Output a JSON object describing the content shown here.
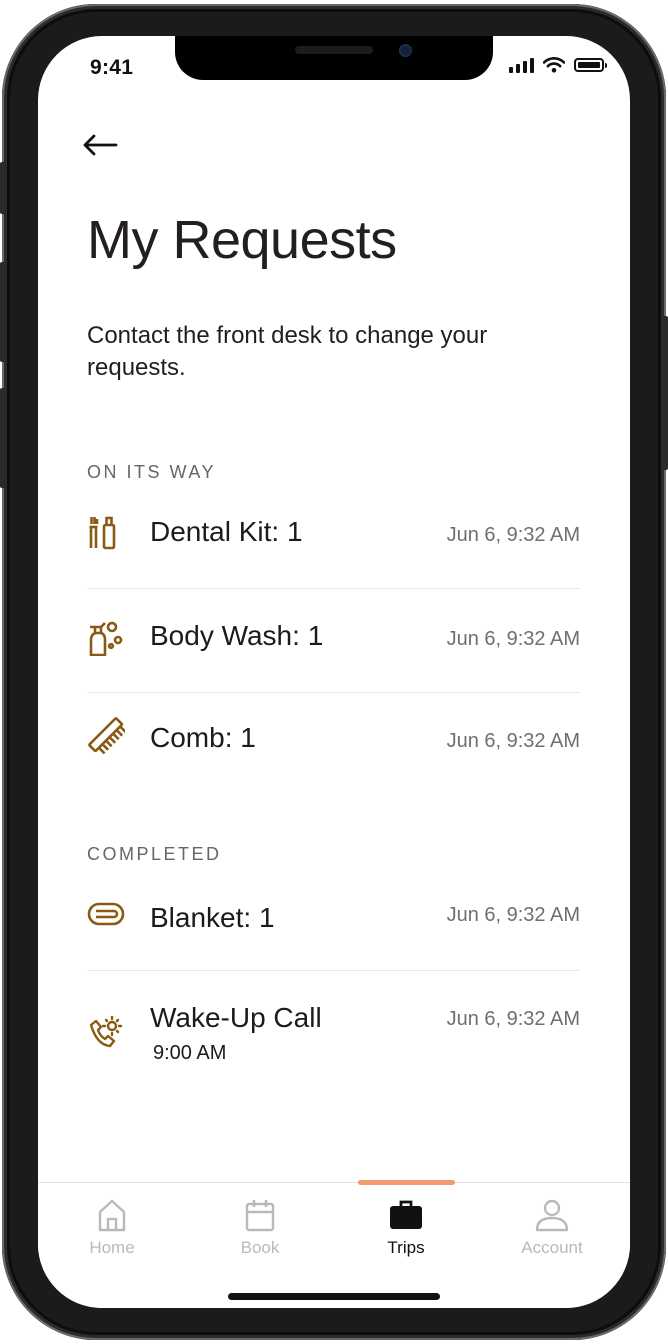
{
  "status_bar": {
    "time": "9:41"
  },
  "header": {
    "back_icon": "arrow-left-icon",
    "title": "My Requests",
    "subtitle": "Contact the front desk to change your requests."
  },
  "sections": [
    {
      "label": "ON ITS WAY",
      "items": [
        {
          "icon": "dental-kit-icon",
          "name": "Dental Kit: 1",
          "time": "Jun 6, 9:32 AM"
        },
        {
          "icon": "body-wash-icon",
          "name": "Body Wash: 1",
          "time": "Jun 6, 9:32 AM"
        },
        {
          "icon": "comb-icon",
          "name": "Comb: 1",
          "time": "Jun 6, 9:32 AM"
        }
      ]
    },
    {
      "label": "COMPLETED",
      "items": [
        {
          "icon": "blanket-icon",
          "name": "Blanket: 1",
          "time": "Jun 6, 9:32 AM"
        },
        {
          "icon": "wake-up-call-icon",
          "name": "Wake-Up Call",
          "detail": "9:00 AM",
          "time": "Jun 6, 9:32 AM"
        }
      ]
    }
  ],
  "tabbar": {
    "tabs": [
      {
        "label": "Home",
        "icon": "home-icon",
        "active": false
      },
      {
        "label": "Book",
        "icon": "calendar-icon",
        "active": false
      },
      {
        "label": "Trips",
        "icon": "briefcase-icon",
        "active": true
      },
      {
        "label": "Account",
        "icon": "user-icon",
        "active": false
      }
    ]
  },
  "colors": {
    "accent_icon": "#8a5a14",
    "active_tab_indicator": "#f19b6e",
    "inactive_tab": "#b9b9b9"
  }
}
